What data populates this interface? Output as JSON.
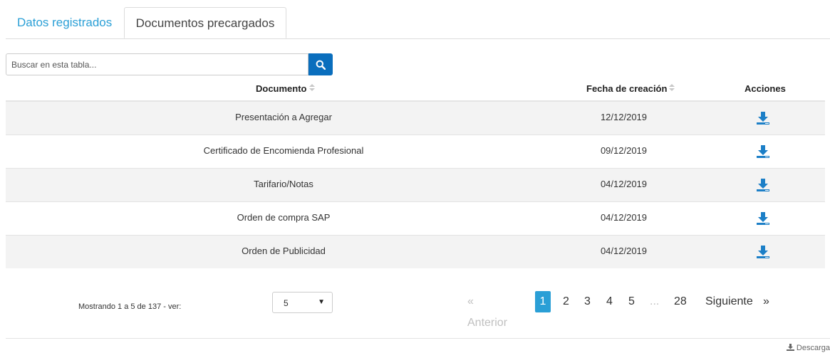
{
  "tabs": [
    {
      "label": "Datos registrados",
      "active": false
    },
    {
      "label": "Documentos precargados",
      "active": true
    }
  ],
  "search": {
    "placeholder": "Buscar en esta tabla...",
    "value": ""
  },
  "table": {
    "headers": {
      "document": "Documento",
      "date": "Fecha de creación",
      "actions": "Acciones"
    },
    "rows": [
      {
        "document": "Presentación a Agregar",
        "date": "12/12/2019",
        "action_icon": "download-icon"
      },
      {
        "document": "Certificado de Encomienda Profesional",
        "date": "09/12/2019",
        "action_icon": "download-icon"
      },
      {
        "document": "Tarifario/Notas",
        "date": "04/12/2019",
        "action_icon": "download-icon"
      },
      {
        "document": "Orden de compra SAP",
        "date": "04/12/2019",
        "action_icon": "download-icon"
      },
      {
        "document": "Orden de Publicidad",
        "date": "04/12/2019",
        "action_icon": "download-icon"
      }
    ]
  },
  "footer": {
    "showing_text": "Mostrando 1 a 5 de 137 - ver:",
    "page_size": "5",
    "pagination": {
      "prev": "« Anterior",
      "pages": [
        "1",
        "2",
        "3",
        "4",
        "5"
      ],
      "ellipsis": "...",
      "last": "28",
      "next_label": "Siguiente",
      "next_arrow": "»",
      "current": "1"
    },
    "download_label": "Descarga"
  },
  "colors": {
    "accent": "#2a9fd6",
    "search_button": "#0a6ebd",
    "row_alt": "#f3f3f3"
  }
}
